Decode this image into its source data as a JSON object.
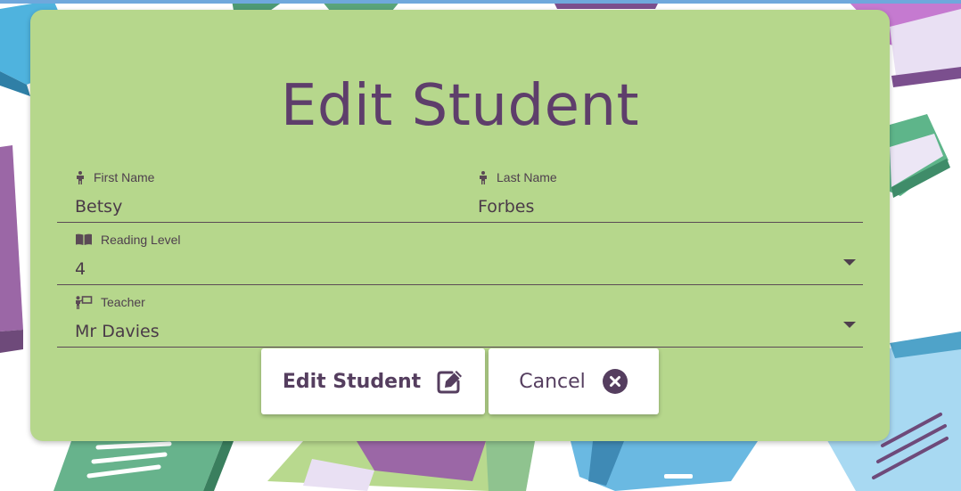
{
  "form": {
    "title": "Edit Student",
    "first_name": {
      "label": "First Name",
      "value": "Betsy",
      "icon": "person-icon"
    },
    "last_name": {
      "label": "Last Name",
      "value": "Forbes",
      "icon": "person-icon"
    },
    "reading_level": {
      "label": "Reading Level",
      "value": "4",
      "icon": "book-icon"
    },
    "teacher": {
      "label": "Teacher",
      "value": "Mr Davies",
      "icon": "teacher-icon"
    }
  },
  "buttons": {
    "edit_label": "Edit Student",
    "edit_icon": "edit-icon",
    "cancel_label": "Cancel",
    "cancel_icon": "cancel-circle-icon"
  },
  "colors": {
    "card_background": "#b6d78c",
    "accent_purple": "#5e3e6b",
    "button_background": "#ffffff"
  }
}
